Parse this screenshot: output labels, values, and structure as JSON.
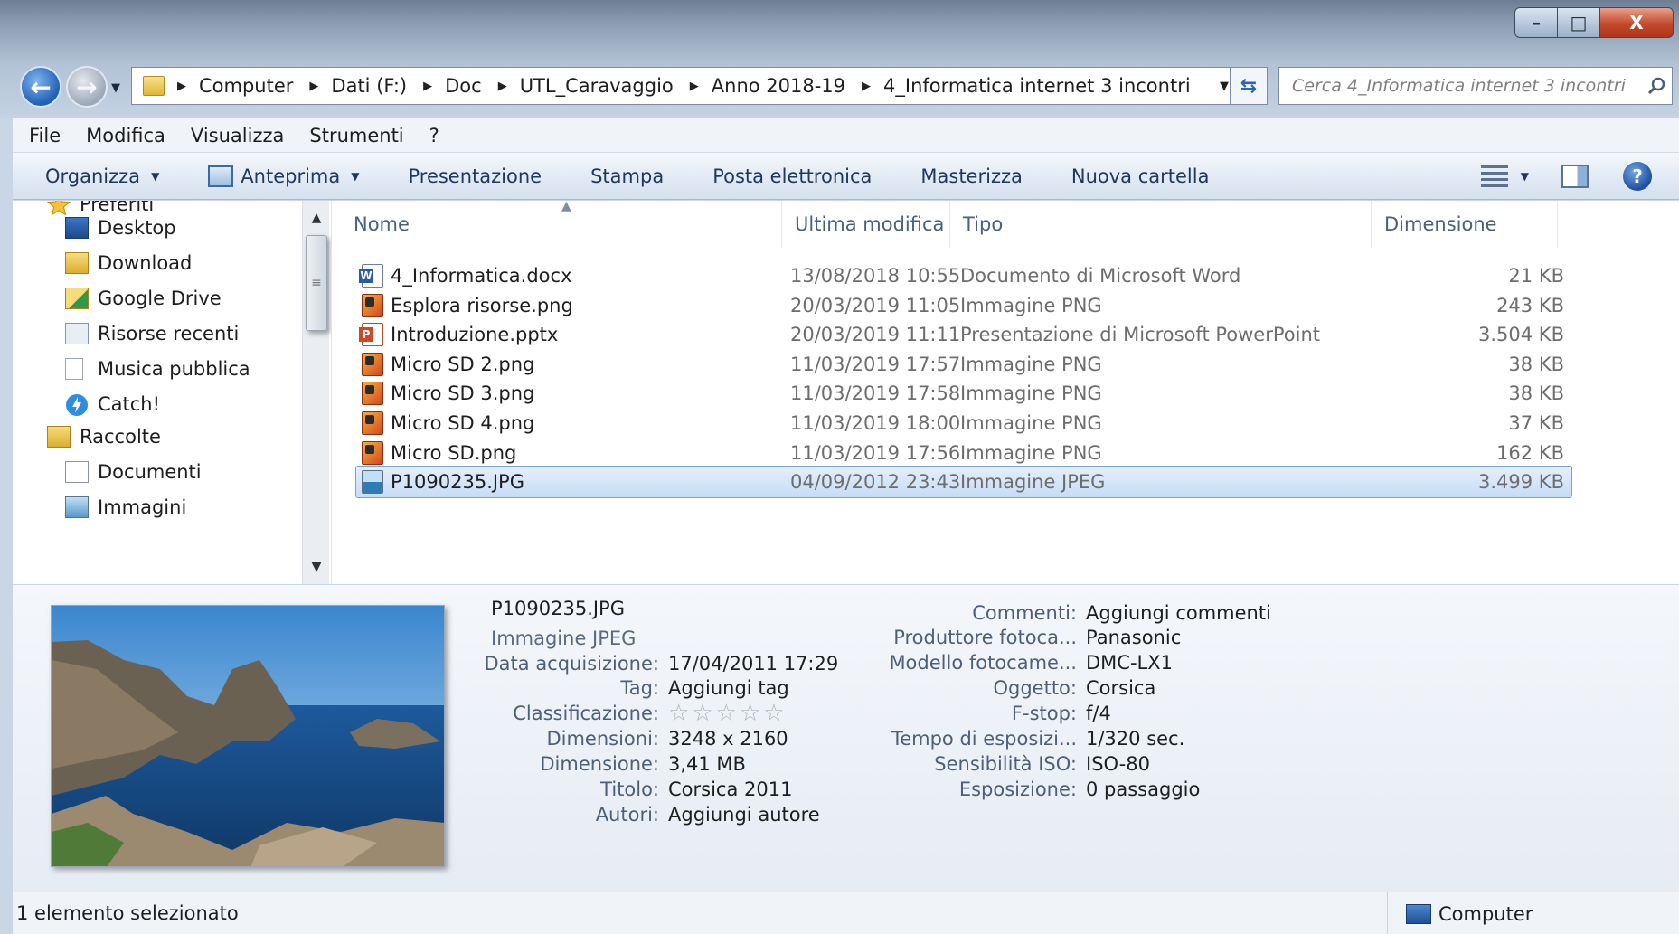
{
  "window": {
    "caption_buttons": {
      "minimize": "–",
      "maximize": "□",
      "close": "X"
    }
  },
  "address": {
    "crumbs": [
      "Computer",
      "Dati (F:)",
      "Doc",
      "UTL_Caravaggio",
      "Anno 2018-19",
      "4_Informatica internet 3 incontri"
    ]
  },
  "search": {
    "placeholder": "Cerca 4_Informatica internet 3 incontri"
  },
  "menu": [
    "File",
    "Modifica",
    "Visualizza",
    "Strumenti",
    "?"
  ],
  "toolbar": {
    "organize": "Organizza",
    "preview": "Anteprima",
    "slideshow": "Presentazione",
    "print": "Stampa",
    "email": "Posta elettronica",
    "burn": "Masterizza",
    "new_folder": "Nuova cartella"
  },
  "nav": {
    "favorites": "Preferiti",
    "favorites_items": [
      "Desktop",
      "Download",
      "Google Drive",
      "Risorse recenti",
      "Musica pubblica",
      "Catch!"
    ],
    "libraries": "Raccolte",
    "libraries_items": [
      "Documenti",
      "Immagini"
    ]
  },
  "columns": {
    "name": "Nome",
    "modified": "Ultima modifica",
    "type": "Tipo",
    "size": "Dimensione"
  },
  "files": [
    {
      "name": "4_Informatica.docx",
      "modified": "13/08/2018 10:55",
      "type": "Documento di Microsoft Word",
      "size": "21 KB",
      "icon": "word-doc-icon"
    },
    {
      "name": "Esplora risorse.png",
      "modified": "20/03/2019 11:05",
      "type": "Immagine PNG",
      "size": "243 KB",
      "icon": "png-image-icon"
    },
    {
      "name": "Introduzione.pptx",
      "modified": "20/03/2019 11:11",
      "type": "Presentazione di Microsoft PowerPoint",
      "size": "3.504 KB",
      "icon": "powerpoint-icon"
    },
    {
      "name": "Micro SD 2.png",
      "modified": "11/03/2019 17:57",
      "type": "Immagine PNG",
      "size": "38 KB",
      "icon": "png-image-icon"
    },
    {
      "name": "Micro SD 3.png",
      "modified": "11/03/2019 17:58",
      "type": "Immagine PNG",
      "size": "38 KB",
      "icon": "png-image-icon"
    },
    {
      "name": "Micro SD 4.png",
      "modified": "11/03/2019 18:00",
      "type": "Immagine PNG",
      "size": "37 KB",
      "icon": "png-image-icon"
    },
    {
      "name": "Micro SD.png",
      "modified": "11/03/2019 17:56",
      "type": "Immagine PNG",
      "size": "162 KB",
      "icon": "png-image-icon"
    },
    {
      "name": "P1090235.JPG",
      "modified": "04/09/2012 23:43",
      "type": "Immagine JPEG",
      "size": "3.499 KB",
      "icon": "jpeg-image-icon",
      "selected": true
    }
  ],
  "details": {
    "filename": "P1090235.JPG",
    "kind": "Immagine JPEG",
    "left_props": [
      {
        "label": "Data acquisizione:",
        "value": "17/04/2011 17:29"
      },
      {
        "label": "Tag:",
        "value": "Aggiungi tag"
      },
      {
        "label": "Classificazione:",
        "value": ""
      },
      {
        "label": "Dimensioni:",
        "value": "3248 x 2160"
      },
      {
        "label": "Dimensione:",
        "value": "3,41 MB"
      },
      {
        "label": "Titolo:",
        "value": "Corsica 2011"
      },
      {
        "label": "Autori:",
        "value": "Aggiungi autore"
      }
    ],
    "rating_stars": 0,
    "right_props": [
      {
        "label": "Commenti:",
        "value": "Aggiungi commenti"
      },
      {
        "label": "Produttore fotoca...",
        "value": "Panasonic"
      },
      {
        "label": "Modello fotocame...",
        "value": "DMC-LX1"
      },
      {
        "label": "Oggetto:",
        "value": "Corsica"
      },
      {
        "label": "F-stop:",
        "value": "f/4"
      },
      {
        "label": "Tempo di esposizi...",
        "value": "1/320 sec."
      },
      {
        "label": "Sensibilità ISO:",
        "value": "ISO-80"
      },
      {
        "label": "Esposizione:",
        "value": "0 passaggio"
      }
    ]
  },
  "status": {
    "selection": "1 elemento selezionato",
    "location": "Computer"
  }
}
